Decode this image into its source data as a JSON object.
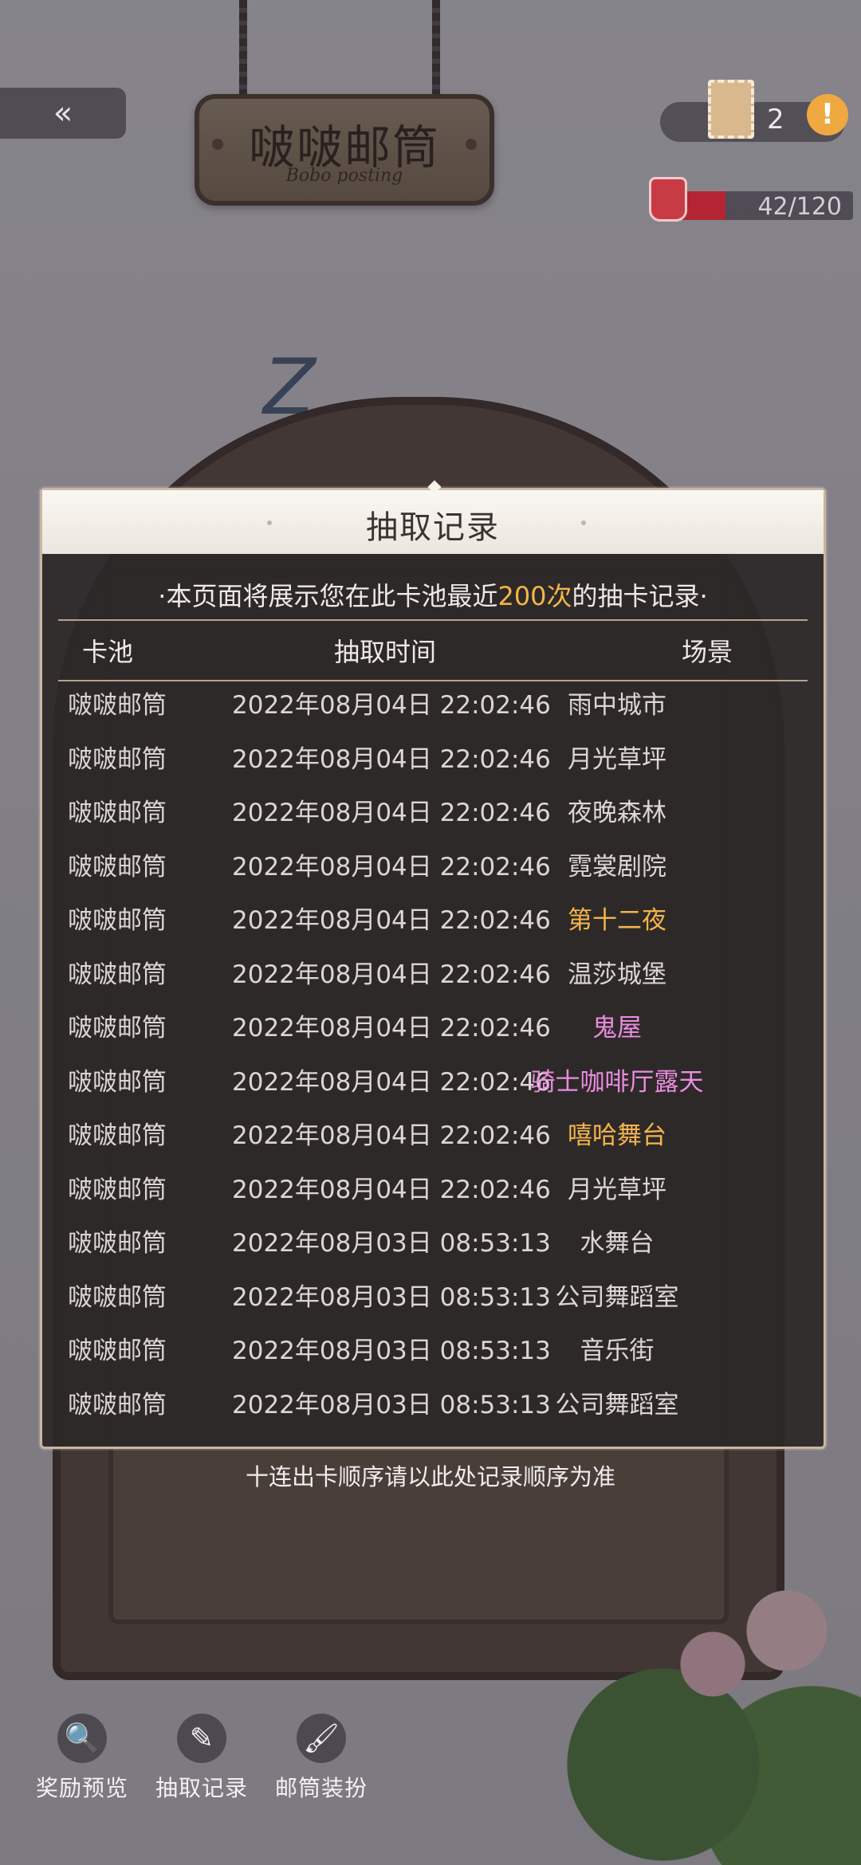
{
  "sign": {
    "title": "啵啵邮筒",
    "subtitle": "Bobo posting"
  },
  "top": {
    "stamp_count": "2",
    "energy_text": "42/120",
    "energy_fraction": 0.35
  },
  "modal": {
    "title": "抽取记录",
    "notice_before": "·本页面将展示您在此卡池最近",
    "notice_highlight": "200次",
    "notice_after": "的抽卡记录·",
    "columns": [
      "卡池",
      "抽取时间",
      "场景"
    ],
    "rows": [
      {
        "pool": "啵啵邮筒",
        "time": "2022年08月04日 22:02:46",
        "scene": "雨中城市",
        "color": "#dcd6d4"
      },
      {
        "pool": "啵啵邮筒",
        "time": "2022年08月04日 22:02:46",
        "scene": "月光草坪",
        "color": "#dcd6d4"
      },
      {
        "pool": "啵啵邮筒",
        "time": "2022年08月04日 22:02:46",
        "scene": "夜晚森林",
        "color": "#dcd6d4"
      },
      {
        "pool": "啵啵邮筒",
        "time": "2022年08月04日 22:02:46",
        "scene": "霓裳剧院",
        "color": "#dcd6d4"
      },
      {
        "pool": "啵啵邮筒",
        "time": "2022年08月04日 22:02:46",
        "scene": "第十二夜",
        "color": "#f3b54a"
      },
      {
        "pool": "啵啵邮筒",
        "time": "2022年08月04日 22:02:46",
        "scene": "温莎城堡",
        "color": "#dcd6d4"
      },
      {
        "pool": "啵啵邮筒",
        "time": "2022年08月04日 22:02:46",
        "scene": "鬼屋",
        "color": "#e98de0"
      },
      {
        "pool": "啵啵邮筒",
        "time": "2022年08月04日 22:02:46",
        "scene": "骑士咖啡厅露天",
        "color": "#e98de0"
      },
      {
        "pool": "啵啵邮筒",
        "time": "2022年08月04日 22:02:46",
        "scene": "嘻哈舞台",
        "color": "#f3b54a"
      },
      {
        "pool": "啵啵邮筒",
        "time": "2022年08月04日 22:02:46",
        "scene": "月光草坪",
        "color": "#dcd6d4"
      },
      {
        "pool": "啵啵邮筒",
        "time": "2022年08月03日 08:53:13",
        "scene": "水舞台",
        "color": "#dcd6d4"
      },
      {
        "pool": "啵啵邮筒",
        "time": "2022年08月03日 08:53:13",
        "scene": "公司舞蹈室",
        "color": "#dcd6d4"
      },
      {
        "pool": "啵啵邮筒",
        "time": "2022年08月03日 08:53:13",
        "scene": "音乐街",
        "color": "#dcd6d4"
      },
      {
        "pool": "啵啵邮筒",
        "time": "2022年08月03日 08:53:13",
        "scene": "公司舞蹈室",
        "color": "#dcd6d4"
      }
    ],
    "footer": "十连出卡顺序请以此处记录顺序为准"
  },
  "nav": [
    {
      "label": "奖励预览",
      "icon": "search-icon"
    },
    {
      "label": "抽取记录",
      "icon": "record-icon"
    },
    {
      "label": "邮筒装扮",
      "icon": "brush-icon"
    }
  ]
}
